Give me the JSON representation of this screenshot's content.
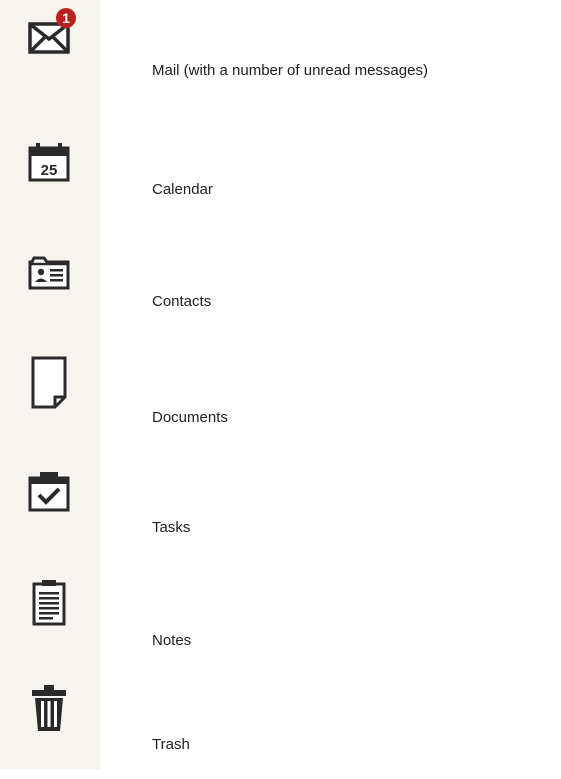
{
  "items": [
    {
      "id": "mail",
      "label": "Mail (with a number of unread messages)",
      "badge": "1",
      "icon": "mail-icon"
    },
    {
      "id": "calendar",
      "label": "Calendar",
      "date": "25",
      "icon": "calendar-icon"
    },
    {
      "id": "contacts",
      "label": "Contacts",
      "icon": "contacts-icon"
    },
    {
      "id": "documents",
      "label": "Documents",
      "icon": "document-icon"
    },
    {
      "id": "tasks",
      "label": "Tasks",
      "icon": "tasks-icon"
    },
    {
      "id": "notes",
      "label": "Notes",
      "icon": "notes-icon"
    },
    {
      "id": "trash",
      "label": "Trash",
      "icon": "trash-icon"
    }
  ],
  "colors": {
    "icon": "#2a2a2a",
    "badge": "#b8211e",
    "rail_background": "#f7f4ef",
    "text": "#1f1f1f"
  }
}
